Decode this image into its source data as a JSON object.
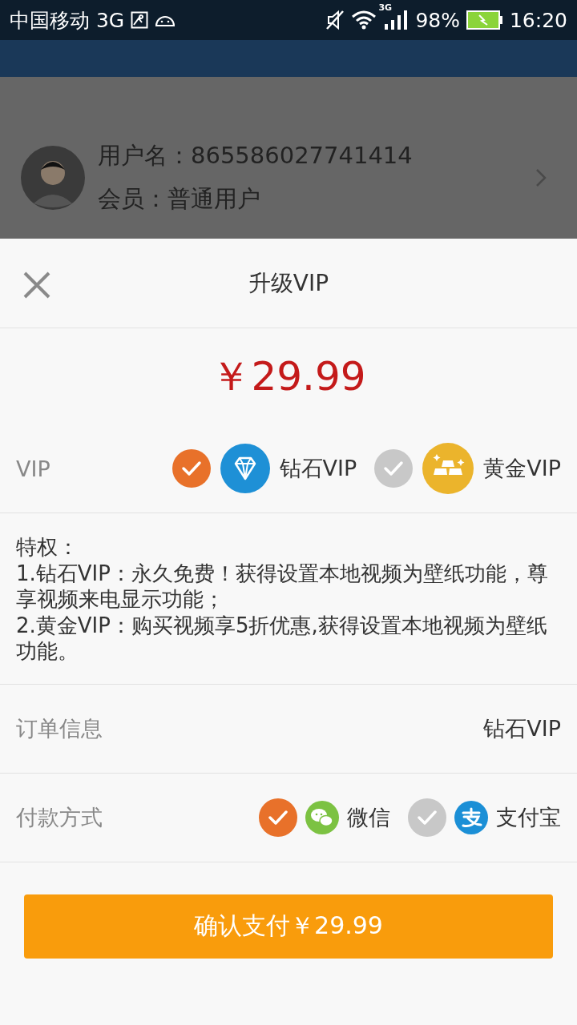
{
  "status_bar": {
    "carrier": "中国移动 3G",
    "network": "3G",
    "battery": "98%",
    "time": "16:20"
  },
  "profile": {
    "username": "用户名：865586027741414",
    "membership": "会员：普通用户"
  },
  "sheet": {
    "title": "升级VIP",
    "price": "￥29.99",
    "vip": {
      "label": "VIP",
      "options": [
        {
          "label": "钻石VIP",
          "kind": "diamond",
          "selected": true
        },
        {
          "label": "黄金VIP",
          "kind": "gold",
          "selected": false
        }
      ]
    },
    "privileges": {
      "heading": "特权：",
      "lines": [
        "1.钻石VIP：永久免费！获得设置本地视频为壁纸功能，尊享视频来电显示功能；",
        "2.黄金VIP：购买视频享5折优惠,获得设置本地视频为壁纸功能。"
      ]
    },
    "order": {
      "label": "订单信息",
      "value": "钻石VIP"
    },
    "payment": {
      "label": "付款方式",
      "options": [
        {
          "label": "微信",
          "kind": "wechat",
          "selected": true
        },
        {
          "label": "支付宝",
          "kind": "alipay",
          "selected": false
        }
      ]
    },
    "confirm_button": "确认支付￥29.99"
  }
}
